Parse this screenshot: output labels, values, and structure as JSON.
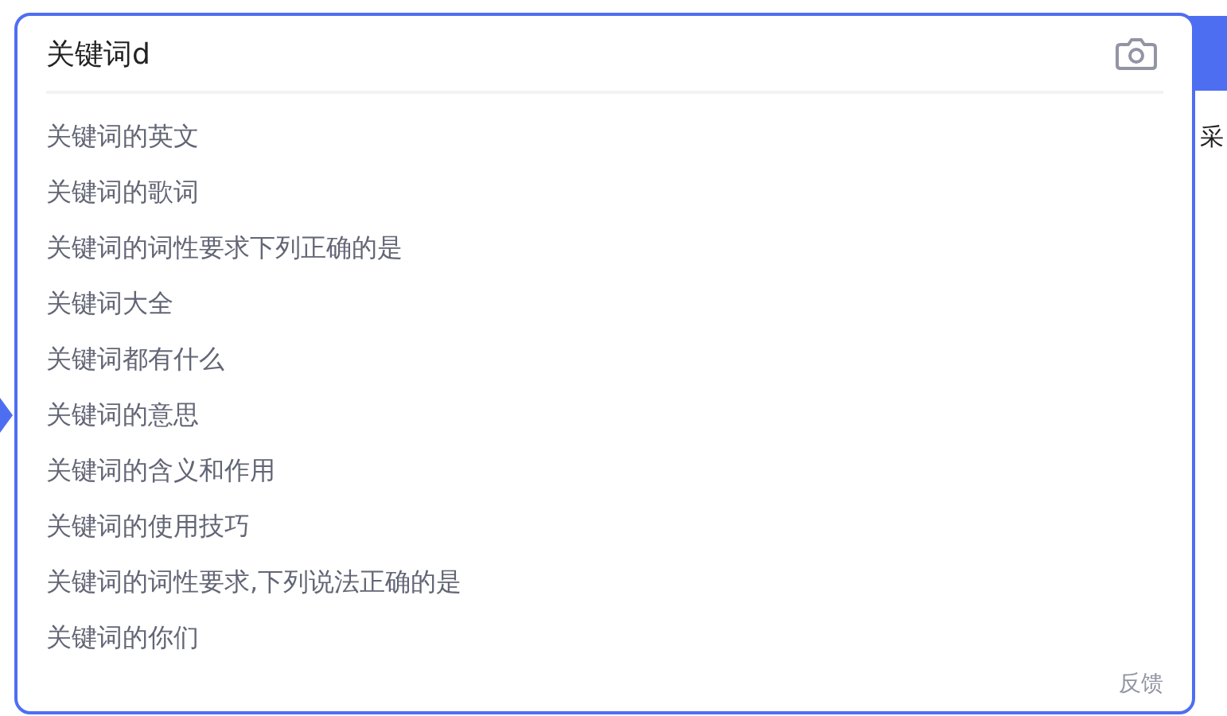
{
  "search": {
    "value": "关键词d"
  },
  "suggestions": [
    "关键词的英文",
    "关键词的歌词",
    "关键词的词性要求下列正确的是",
    "关键词大全",
    "关键词都有什么",
    "关键词的意思",
    "关键词的含义和作用",
    "关键词的使用技巧",
    "关键词的词性要求,下列说法正确的是",
    "关键词的你们"
  ],
  "feedback": "反馈",
  "background_text": "采"
}
